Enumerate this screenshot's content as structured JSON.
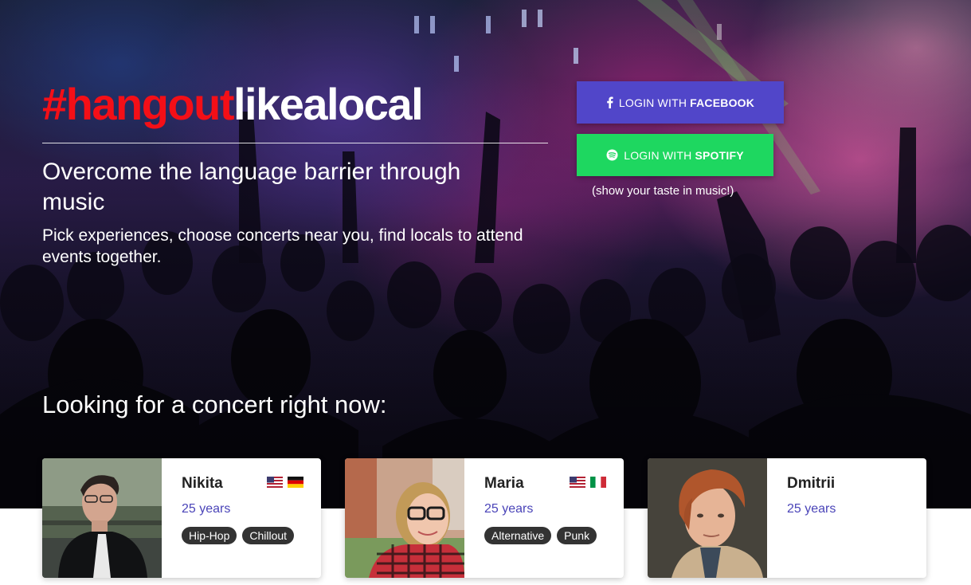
{
  "hero": {
    "headline_hash": "#hangout",
    "headline_rest": "likealocal",
    "tagline": "Overcome the language barrier through music",
    "subtext": "Pick experiences, choose concerts near you, find locals to attend events together."
  },
  "login": {
    "facebook": {
      "prefix": "LOGIN WITH",
      "brand": "FACEBOOK",
      "icon": "facebook-icon",
      "color": "#5146c9"
    },
    "spotify": {
      "prefix": "LOGIN WITH",
      "brand": "SPOTIFY",
      "icon": "spotify-icon",
      "color": "#1ed760"
    },
    "spotify_note": "(show your taste in music!)"
  },
  "concerts": {
    "title": "Looking for a concert right now:",
    "people": [
      {
        "name": "Nikita",
        "age": "25 years",
        "flags": [
          "us-flag-icon",
          "de-flag-icon"
        ],
        "tags": [
          "Hip-Hop",
          "Chillout"
        ]
      },
      {
        "name": "Maria",
        "age": "25 years",
        "flags": [
          "us-flag-icon",
          "it-flag-icon"
        ],
        "tags": [
          "Alternative",
          "Punk"
        ]
      },
      {
        "name": "Dmitrii",
        "age": "25 years",
        "flags": [],
        "tags": []
      }
    ]
  },
  "colors": {
    "accent_red": "#f40f17",
    "age_text": "#4a44b8",
    "tag_bg": "#333333"
  }
}
